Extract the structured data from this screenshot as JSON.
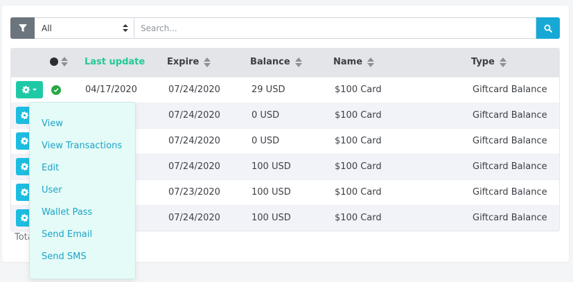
{
  "toolbar": {
    "select_value": "All",
    "search_placeholder": "Search..."
  },
  "table": {
    "headers": {
      "last_update": "Last update",
      "expire": "Expire",
      "balance": "Balance",
      "name": "Name",
      "type": "Type"
    },
    "rows": [
      {
        "last_update": "04/17/2020",
        "expire": "07/24/2020",
        "balance": "29 USD",
        "name": "$100 Card",
        "type": "Giftcard Balance"
      },
      {
        "last_update": "",
        "expire": "07/24/2020",
        "balance": "0 USD",
        "name": "$100 Card",
        "type": "Giftcard Balance"
      },
      {
        "last_update": "",
        "expire": "07/24/2020",
        "balance": "0 USD",
        "name": "$100 Card",
        "type": "Giftcard Balance"
      },
      {
        "last_update": "",
        "expire": "07/24/2020",
        "balance": "100 USD",
        "name": "$100 Card",
        "type": "Giftcard Balance"
      },
      {
        "last_update": "",
        "expire": "07/23/2020",
        "balance": "100 USD",
        "name": "$100 Card",
        "type": "Giftcard Balance"
      },
      {
        "last_update": "",
        "expire": "07/24/2020",
        "balance": "100 USD",
        "name": "$100 Card",
        "type": "Giftcard Balance"
      }
    ]
  },
  "footer": {
    "total_label": "Tota"
  },
  "dropdown": {
    "items": [
      "View",
      "View Transactions",
      "Edit",
      "User",
      "Wallet Pass",
      "Send Email",
      "Send SMS"
    ]
  },
  "colors": {
    "accent_green": "#20c997",
    "accent_blue": "#17a9d6",
    "dropdown_bg": "#e4fbf7",
    "dropdown_text": "#1da3c9"
  }
}
